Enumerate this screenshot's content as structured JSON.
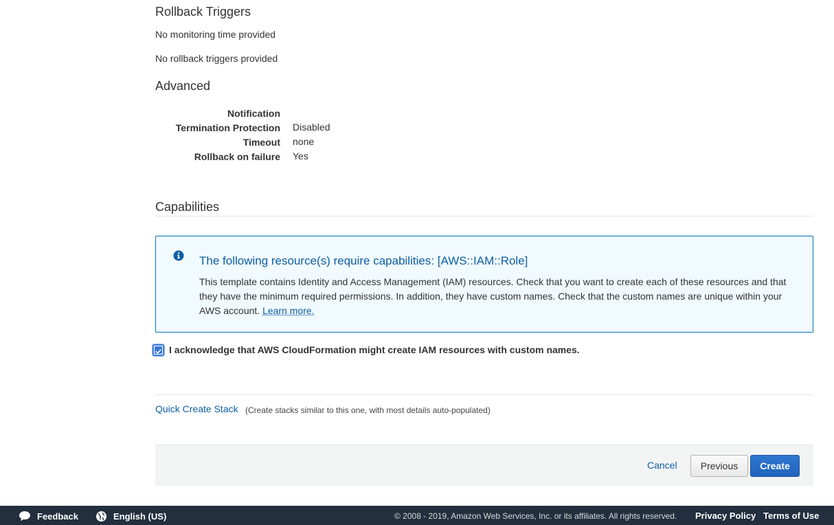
{
  "rollback": {
    "title": "Rollback Triggers",
    "monitoring_text": "No monitoring time provided",
    "triggers_text": "No rollback triggers provided"
  },
  "advanced": {
    "title": "Advanced",
    "rows": [
      {
        "label": "Notification",
        "value": ""
      },
      {
        "label": "Termination Protection",
        "value": "Disabled"
      },
      {
        "label": "Timeout",
        "value": "none"
      },
      {
        "label": "Rollback on failure",
        "value": "Yes"
      }
    ]
  },
  "capabilities": {
    "title": "Capabilities",
    "info_title": "The following resource(s) require capabilities: [AWS::IAM::Role]",
    "info_body": "This template contains Identity and Access Management (IAM) resources. Check that you want to create each of these resources and that they have the minimum required permissions. In addition, they have custom names. Check that the custom names are unique within your AWS account.",
    "learn_more": "Learn more.",
    "ack_label": "I acknowledge that AWS CloudFormation might create IAM resources with custom names.",
    "ack_checked": true
  },
  "quick_create": {
    "link": "Quick Create Stack",
    "note": "(Create stacks similar to this one, with most details auto-populated)"
  },
  "buttons": {
    "cancel": "Cancel",
    "previous": "Previous",
    "create": "Create"
  },
  "footer": {
    "feedback": "Feedback",
    "language": "English (US)",
    "copyright": "© 2008 - 2019, Amazon Web Services, Inc. or its affiliates. All rights reserved.",
    "privacy": "Privacy Policy",
    "terms": "Terms of Use"
  },
  "colors": {
    "link": "#0d5ea5",
    "info_border": "#0073bb",
    "info_bg": "#f1faff",
    "primary_button": "#1f62bb",
    "footer_bg": "#232f3e"
  }
}
